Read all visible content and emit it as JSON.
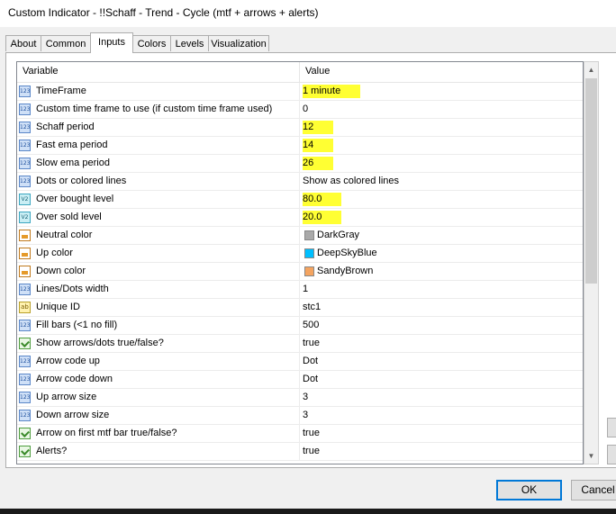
{
  "window": {
    "title": "Custom Indicator - !!Schaff - Trend - Cycle (mtf + arrows + alerts)"
  },
  "tabs": [
    {
      "label": "About",
      "active": false
    },
    {
      "label": "Common",
      "active": false
    },
    {
      "label": "Inputs",
      "active": true
    },
    {
      "label": "Colors",
      "active": false
    },
    {
      "label": "Levels",
      "active": false
    },
    {
      "label": "Visualization",
      "active": false
    }
  ],
  "grid": {
    "columns": [
      "Variable",
      "Value"
    ],
    "rows": [
      {
        "name": "TimeFrame",
        "value": "1 minute",
        "icon": "int-icon",
        "highlight": true
      },
      {
        "name": "Custom time frame to use (if custom time frame used)",
        "value": "0",
        "icon": "int-icon"
      },
      {
        "name": "Schaff period",
        "value": "12",
        "icon": "int-icon",
        "highlight": true
      },
      {
        "name": "Fast ema period",
        "value": "14",
        "icon": "int-icon",
        "highlight": true
      },
      {
        "name": "Slow ema period",
        "value": "26",
        "icon": "int-icon",
        "highlight": true
      },
      {
        "name": "Dots or colored lines",
        "value": "Show as colored lines",
        "icon": "int-icon"
      },
      {
        "name": "Over bought level",
        "value": "80.0",
        "icon": "double-icon",
        "highlight": true
      },
      {
        "name": "Over sold level",
        "value": "20.0",
        "icon": "double-icon",
        "highlight": true
      },
      {
        "name": "Neutral color",
        "value": "DarkGray",
        "icon": "color-icon",
        "swatch": "#a9a9a9"
      },
      {
        "name": "Up color",
        "value": "DeepSkyBlue",
        "icon": "color-icon",
        "swatch": "#00bfff"
      },
      {
        "name": "Down color",
        "value": "SandyBrown",
        "icon": "color-icon",
        "swatch": "#f4a460"
      },
      {
        "name": "Lines/Dots width",
        "value": "1",
        "icon": "int-icon"
      },
      {
        "name": "Unique ID",
        "value": "stc1",
        "icon": "string-icon"
      },
      {
        "name": "Fill bars (<1 no fill)",
        "value": "500",
        "icon": "int-icon"
      },
      {
        "name": "Show arrows/dots true/false?",
        "value": "true",
        "icon": "bool-icon"
      },
      {
        "name": "Arrow code up",
        "value": "Dot",
        "icon": "int-icon"
      },
      {
        "name": "Arrow code down",
        "value": "Dot",
        "icon": "int-icon"
      },
      {
        "name": "Up arrow size",
        "value": "3",
        "icon": "int-icon"
      },
      {
        "name": "Down arrow size",
        "value": "3",
        "icon": "int-icon"
      },
      {
        "name": "Arrow on first mtf bar true/false?",
        "value": "true",
        "icon": "bool-icon"
      },
      {
        "name": "Alerts?",
        "value": "true",
        "icon": "bool-icon"
      }
    ]
  },
  "icon_text": {
    "int": "123",
    "double": "V2",
    "string": "ab"
  },
  "buttons": {
    "ok": "OK",
    "cancel": "Cancel"
  },
  "colors": {
    "highlight": "#ffff33",
    "accent": "#0078d7"
  }
}
